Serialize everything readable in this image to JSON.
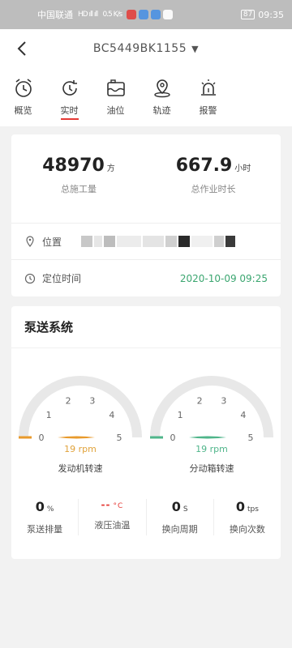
{
  "statusbar": {
    "carrier": "中国联通",
    "signal": "HD ıll ıll",
    "speed": "0.5 K/s",
    "battery": "87",
    "time": "09:35"
  },
  "navbar": {
    "title": "BC5449BK1155",
    "caret": "▼"
  },
  "tabs": [
    {
      "label": "概览",
      "icon": "alarm-clock-icon"
    },
    {
      "label": "实时",
      "icon": "refresh-clock-icon",
      "active": true
    },
    {
      "label": "油位",
      "icon": "fuel-tank-icon"
    },
    {
      "label": "轨迹",
      "icon": "location-pin-icon"
    },
    {
      "label": "报警",
      "icon": "alarm-light-icon"
    }
  ],
  "overview": {
    "work_amount": {
      "value": "48970",
      "unit": "方",
      "label": "总施工量"
    },
    "work_hours": {
      "value": "667.9",
      "unit": "小时",
      "label": "总作业时长"
    },
    "location_label": "位置",
    "locate_time_label": "定位时间",
    "locate_time": "2020-10-09 09:25"
  },
  "pump_system": {
    "title": "泵送系统",
    "engine": {
      "rpm_text": "19 rpm",
      "name": "发动机转速",
      "value": 0.19,
      "color": "#e89a2c",
      "ticks": [
        "0",
        "1",
        "2",
        "3",
        "4",
        "5"
      ]
    },
    "transfer": {
      "rpm_text": "19 rpm",
      "name": "分动箱转速",
      "value": 0.19,
      "color": "#4fb58a",
      "ticks": [
        "0",
        "1",
        "2",
        "3",
        "4",
        "5"
      ]
    },
    "metrics": [
      {
        "value": "0",
        "unit": "%",
        "label": "泵送排量"
      },
      {
        "value": "--",
        "unit": "°C",
        "label": "液压油温"
      },
      {
        "value": "0",
        "unit": "S",
        "label": "换向周期"
      },
      {
        "value": "0",
        "unit": "tps",
        "label": "换向次数"
      }
    ]
  }
}
